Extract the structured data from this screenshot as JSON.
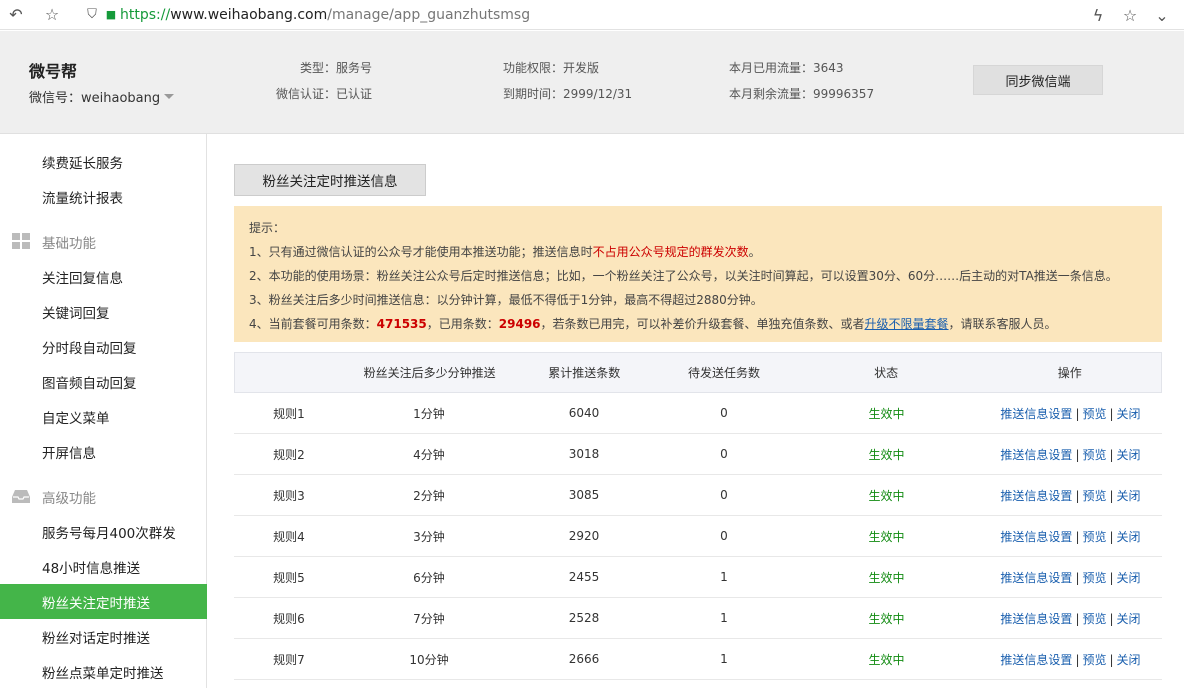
{
  "browser": {
    "url_scheme": "https://",
    "url_host": "www.weihaobang.com",
    "url_path": "/manage/app_guanzhutsmsg"
  },
  "header": {
    "brand": "微号帮",
    "account": "微信号：weihaobang",
    "type": "类型：服务号",
    "auth": "微信认证：已认证",
    "permission": "功能权限：开发版",
    "expire": "到期时间：2999/12/31",
    "used_traffic": "本月已用流量：3643",
    "remain_traffic": "本月剩余流量：99996357",
    "sync_button": "同步微信端"
  },
  "sidebar": {
    "items_top": [
      "续费延长服务",
      "流量统计报表"
    ],
    "group_basic": "基础功能",
    "items_basic": [
      "关注回复信息",
      "关键词回复",
      "分时段自动回复",
      "图音频自动回复",
      "自定义菜单",
      "开屏信息"
    ],
    "group_advanced": "高级功能",
    "items_advanced": [
      "服务号每月400次群发",
      "48小时信息推送",
      "粉丝关注定时推送",
      "粉丝对话定时推送",
      "粉丝点菜单定时推送"
    ],
    "active": "粉丝关注定时推送"
  },
  "main": {
    "tab": "粉丝关注定时推送信息",
    "notice": {
      "title": "提示：",
      "l1_a": "1、只有通过微信认证的公众号才能使用本推送功能；推送信息时",
      "l1_red": "不占用公众号规定的群发次数",
      "l1_b": "。",
      "l2": "2、本功能的使用场景：粉丝关注公众号后定时推送信息；比如，一个粉丝关注了公众号，以关注时间算起，可以设置30分、60分……后主动的对TA推送一条信息。",
      "l3": "3、粉丝关注后多少时间推送信息：以分钟计算，最低不得低于1分钟，最高不得超过2880分钟。",
      "l4_a": "4、当前套餐可用条数：",
      "l4_avail": "471535",
      "l4_b": "，已用条数：",
      "l4_used": "29496",
      "l4_c": "，若条数已用完，可以补差价升级套餐、单独充值条数、或者",
      "l4_link": "升级不限量套餐",
      "l4_d": "，请联系客服人员。"
    },
    "table": {
      "headers": [
        "",
        "粉丝关注后多少分钟推送",
        "累计推送条数",
        "待发送任务数",
        "状态",
        "操作"
      ],
      "rows": [
        {
          "name": "规则1",
          "minutes": "1分钟",
          "total": "6040",
          "pending": "0",
          "status": "生效中"
        },
        {
          "name": "规则2",
          "minutes": "4分钟",
          "total": "3018",
          "pending": "0",
          "status": "生效中"
        },
        {
          "name": "规则3",
          "minutes": "2分钟",
          "total": "3085",
          "pending": "0",
          "status": "生效中"
        },
        {
          "name": "规则4",
          "minutes": "3分钟",
          "total": "2920",
          "pending": "0",
          "status": "生效中"
        },
        {
          "name": "规则5",
          "minutes": "6分钟",
          "total": "2455",
          "pending": "1",
          "status": "生效中"
        },
        {
          "name": "规则6",
          "minutes": "7分钟",
          "total": "2528",
          "pending": "1",
          "status": "生效中"
        },
        {
          "name": "规则7",
          "minutes": "10分钟",
          "total": "2666",
          "pending": "1",
          "status": "生效中"
        }
      ],
      "op_settings": "推送信息设置",
      "op_preview": "预览",
      "op_close": "关闭",
      "op_sep": "|"
    }
  },
  "colors": {
    "accent": "#44b549",
    "notice_bg": "#fbe6bd",
    "status_green": "#138c13",
    "link_blue": "#1a5fae"
  }
}
